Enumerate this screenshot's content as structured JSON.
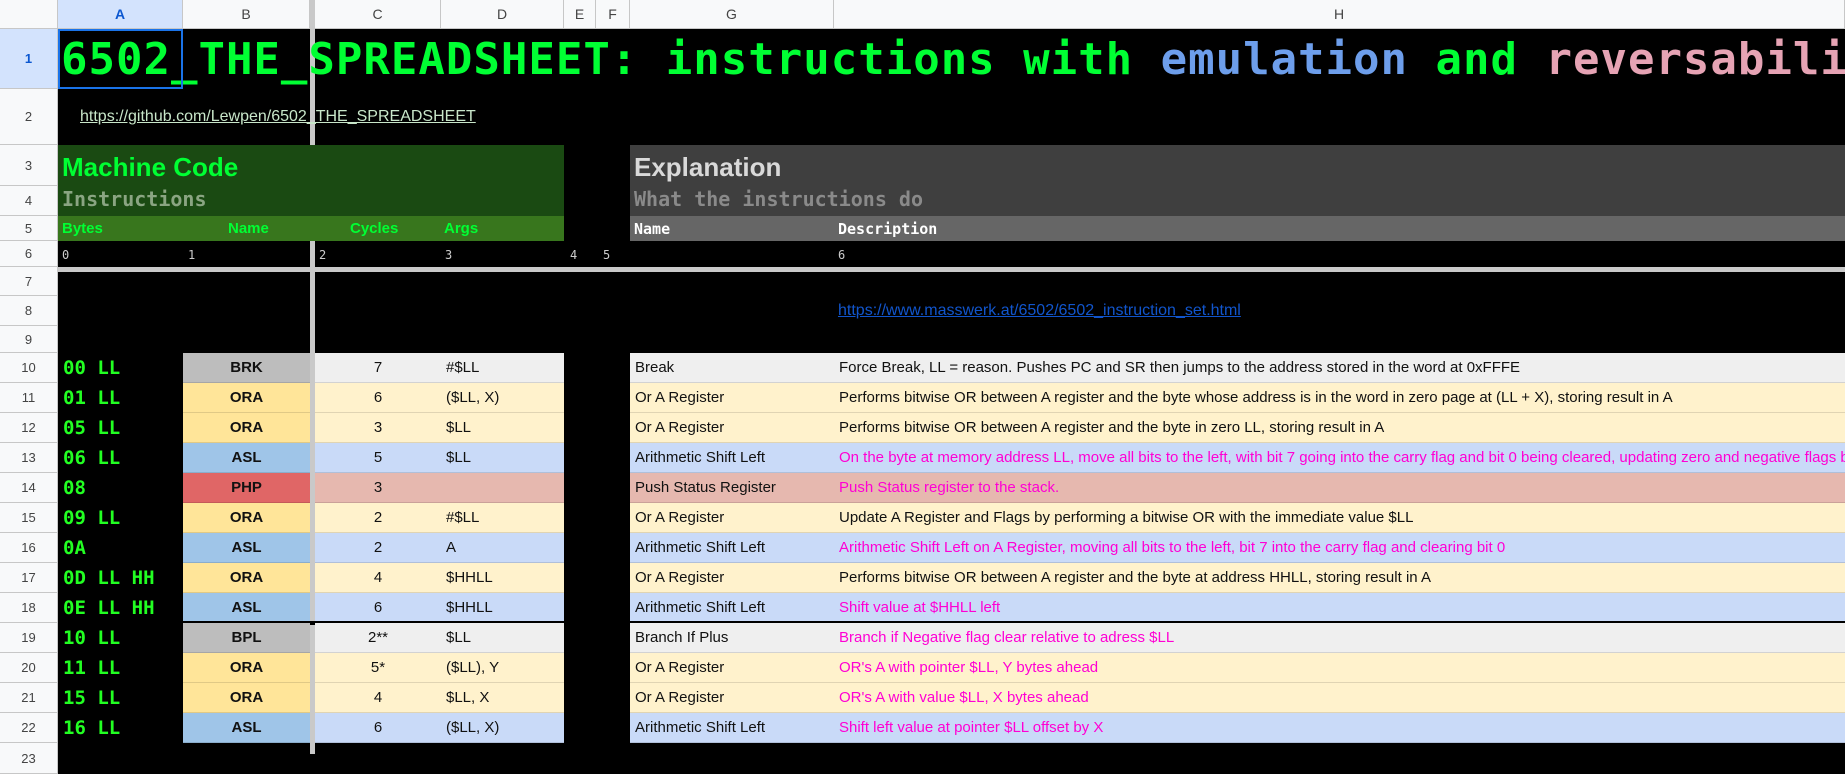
{
  "columns": [
    "A",
    "B",
    "C",
    "D",
    "E",
    "F",
    "G",
    "H"
  ],
  "rows": [
    "1",
    "2",
    "3",
    "4",
    "5",
    "6",
    "7",
    "8",
    "9",
    "10",
    "11",
    "12",
    "13",
    "14",
    "15",
    "16",
    "17",
    "18",
    "19",
    "20",
    "21",
    "22",
    "23"
  ],
  "title": {
    "part1": "6502_THE_SPREADSHEET: instructions with ",
    "part2": "emulation",
    "part3": " and ",
    "part4": "reversability"
  },
  "repo_link": "https://github.com/Lewpen/6502_THE_SPREADSHEET",
  "left_section": {
    "heading": "Machine Code",
    "subheading": "Instructions",
    "col_bytes": "Bytes",
    "col_name": "Name",
    "col_cycles": "Cycles",
    "col_args": "Args"
  },
  "right_section": {
    "heading": "Explanation",
    "subheading": "What the instructions do",
    "col_name": "Name",
    "col_description": "Description"
  },
  "index_row": [
    "0",
    "1",
    "2",
    "3",
    "4",
    "5",
    "6"
  ],
  "reference_link": "https://www.masswerk.at/6502/6502_instruction_set.html",
  "instructions": [
    {
      "bytes": "00 LL",
      "name": "BRK",
      "cycles": "7",
      "args": "#$LL",
      "fullname": "Break",
      "desc": "Force Break, LL = reason. Pushes PC and SR then jumps to the address stored in the word at 0xFFFE"
    },
    {
      "bytes": "01 LL",
      "name": "ORA",
      "cycles": "6",
      "args": "($LL, X)",
      "fullname": "Or A Register",
      "desc": "Performs bitwise OR between A register and the byte whose address is in the word in zero page at (LL + X), storing result in A"
    },
    {
      "bytes": "05 LL",
      "name": "ORA",
      "cycles": "3",
      "args": "$LL",
      "fullname": "Or A Register",
      "desc": "Performs bitwise OR between A register and the byte in zero LL, storing result in A"
    },
    {
      "bytes": "06 LL",
      "name": "ASL",
      "cycles": "5",
      "args": "$LL",
      "fullname": "Arithmetic Shift Left",
      "desc": "On the byte at memory address LL, move all bits to the left, with bit 7 going into the carry flag and bit 0 being cleared, updating zero and negative flags b"
    },
    {
      "bytes": "08",
      "name": "PHP",
      "cycles": "3",
      "args": "",
      "fullname": "Push Status Register",
      "desc": "Push Status register to the stack."
    },
    {
      "bytes": "09 LL",
      "name": "ORA",
      "cycles": "2",
      "args": "#$LL",
      "fullname": "Or A Register",
      "desc": "Update A Register and Flags by performing a bitwise OR with the immediate value $LL"
    },
    {
      "bytes": "0A",
      "name": "ASL",
      "cycles": "2",
      "args": "A",
      "fullname": "Arithmetic Shift Left",
      "desc": "Arithmetic Shift Left on A Register, moving all bits to the left, bit 7 into the carry flag and clearing bit 0"
    },
    {
      "bytes": "0D LL HH",
      "name": "ORA",
      "cycles": "4",
      "args": "$HHLL",
      "fullname": "Or A Register",
      "desc": "Performs bitwise OR between A register and the byte at address HHLL, storing result in A"
    },
    {
      "bytes": "0E LL HH",
      "name": "ASL",
      "cycles": "6",
      "args": "$HHLL",
      "fullname": "Arithmetic Shift Left",
      "desc": "Shift value at $HHLL left"
    },
    {
      "bytes": "10 LL",
      "name": "BPL",
      "cycles": "2**",
      "args": "$LL",
      "fullname": "Branch If Plus",
      "desc": "Branch if Negative flag clear relative to adress $LL"
    },
    {
      "bytes": "11 LL",
      "name": "ORA",
      "cycles": "5*",
      "args": "($LL), Y",
      "fullname": "Or A Register",
      "desc": "OR's A with pointer $LL, Y bytes ahead"
    },
    {
      "bytes": "15 LL",
      "name": "ORA",
      "cycles": "4",
      "args": "$LL, X",
      "fullname": "Or A Register",
      "desc": "OR's A with value $LL, X bytes ahead"
    },
    {
      "bytes": "16 LL",
      "name": "ASL",
      "cycles": "6",
      "args": "($LL, X)",
      "fullname": "Arithmetic Shift Left",
      "desc": "Shift left value at pointer $LL offset by X"
    }
  ],
  "colors": {
    "green_text": "#00ff33",
    "emulation_blue": "#6d9eeb",
    "reversability_pink": "#e6a3b4",
    "brk": "#bdbdbd",
    "ora": "#ffe599",
    "asl": "#9fc5e8",
    "php": "#e06666",
    "desc_magenta": "#ff00d4"
  }
}
